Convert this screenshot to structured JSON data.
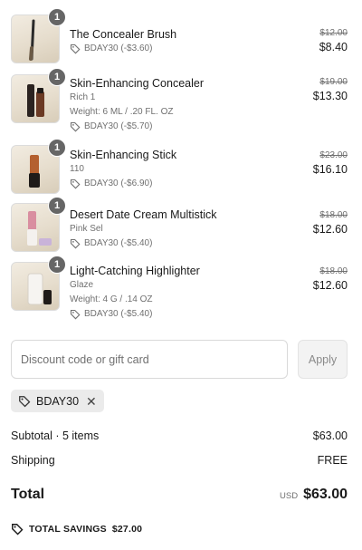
{
  "items": [
    {
      "name": "The Concealer Brush",
      "quantity": "1",
      "variant": "",
      "weight": "",
      "discount": "BDAY30 (-$3.60)",
      "original_price": "$12.00",
      "final_price": "$8.40",
      "thumbnail_icon": "brush-product-image"
    },
    {
      "name": "Skin-Enhancing Concealer",
      "quantity": "1",
      "variant": "Rich 1",
      "weight": "Weight: 6 ML / .20 FL. OZ",
      "discount": "BDAY30 (-$5.70)",
      "original_price": "$19.00",
      "final_price": "$13.30",
      "thumbnail_icon": "concealer-product-image"
    },
    {
      "name": "Skin-Enhancing Stick",
      "quantity": "1",
      "variant": "110",
      "weight": "",
      "discount": "BDAY30 (-$6.90)",
      "original_price": "$23.00",
      "final_price": "$16.10",
      "thumbnail_icon": "stick-product-image"
    },
    {
      "name": "Desert Date Cream Multistick",
      "quantity": "1",
      "variant": "Pink Sel",
      "weight": "",
      "discount": "BDAY30 (-$5.40)",
      "original_price": "$18.00",
      "final_price": "$12.60",
      "thumbnail_icon": "multistick-product-image"
    },
    {
      "name": "Light-Catching Highlighter",
      "quantity": "1",
      "variant": "Glaze",
      "weight": "Weight: 4 G / .14 OZ",
      "discount": "BDAY30 (-$5.40)",
      "original_price": "$18.00",
      "final_price": "$12.60",
      "thumbnail_icon": "highlighter-product-image"
    }
  ],
  "discount": {
    "placeholder": "Discount code or gift card",
    "value": "",
    "apply_label": "Apply",
    "applied_code": "BDAY30"
  },
  "summary": {
    "subtotal_label": "Subtotal · 5 items",
    "subtotal_value": "$63.00",
    "shipping_label": "Shipping",
    "shipping_value": "FREE",
    "total_label": "Total",
    "currency": "USD",
    "total_value": "$63.00",
    "savings_label": "TOTAL SAVINGS",
    "savings_value": "$27.00"
  },
  "colors": {
    "badge": "#666666",
    "muted_text": "#707070",
    "text": "#1a1a1a"
  }
}
